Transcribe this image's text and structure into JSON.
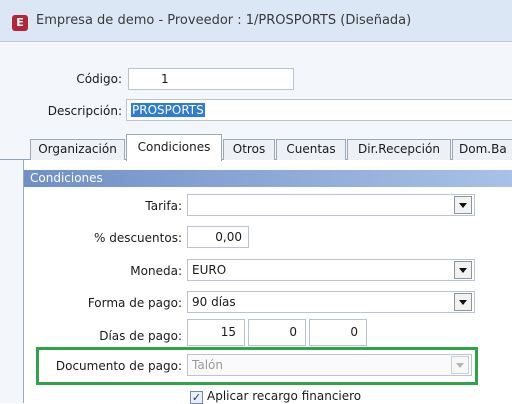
{
  "window": {
    "title": "Empresa de demo - Proveedor : 1/PROSPORTS (Diseñada)",
    "icon_letter": "E"
  },
  "header": {
    "codigo_label": "Código:",
    "codigo_value": "1",
    "descripcion_label": "Descripción:",
    "descripcion_value": "PROSPORTS"
  },
  "tabs": [
    {
      "label": "Organización",
      "active": false
    },
    {
      "label": "Condiciones",
      "active": true
    },
    {
      "label": "Otros",
      "active": false
    },
    {
      "label": "Cuentas",
      "active": false
    },
    {
      "label": "Dir.Recepción",
      "active": false
    },
    {
      "label": "Dom.Ba",
      "active": false
    }
  ],
  "section": {
    "title": "Condiciones"
  },
  "form": {
    "tarifa_label": "Tarifa:",
    "tarifa_value": "",
    "descuentos_label": "% descuentos:",
    "descuentos_value": "0,00",
    "moneda_label": "Moneda:",
    "moneda_value": "EURO",
    "forma_pago_label": "Forma de pago:",
    "forma_pago_value": "90 días",
    "dias_pago_label": "Días de pago:",
    "dias_pago_values": [
      "15",
      "0",
      "0"
    ],
    "documento_pago_label": "Documento de pago:",
    "documento_pago_value": "Talón",
    "recargo_label": "Aplicar recargo financiero",
    "recargo_checked": true
  },
  "colors": {
    "highlight": "#2fa24b",
    "section_band": "#6f8fc6",
    "selection": "#2f7bd5"
  }
}
